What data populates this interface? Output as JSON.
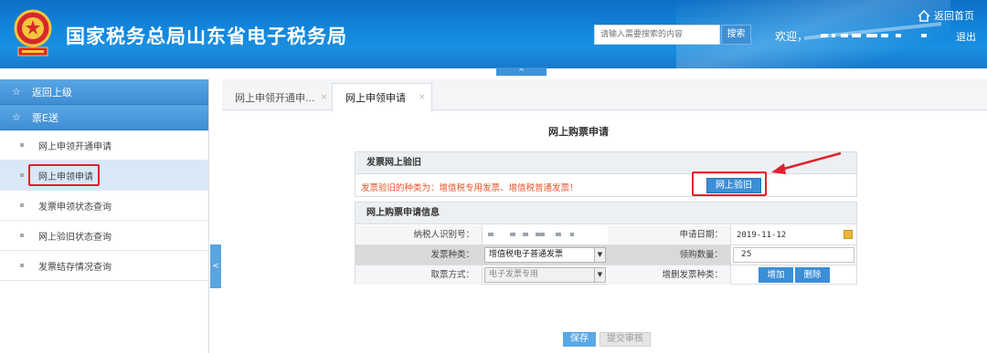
{
  "header": {
    "site_title": "国家税务总局山东省电子税务局",
    "search_placeholder": "请输入需要搜索的内容",
    "search_button": "搜索",
    "welcome": "欢迎，",
    "home_link": "返回首页",
    "logout": "退出",
    "collapse_arrow": "^"
  },
  "sidebar": {
    "back": "返回上级",
    "section": "票E送",
    "items": [
      {
        "label": "网上申领开通申请"
      },
      {
        "label": "网上申领申请"
      },
      {
        "label": "发票申领状态查询"
      },
      {
        "label": "网上验旧状态查询"
      },
      {
        "label": "发票结存情况查询"
      }
    ],
    "toggle": "<"
  },
  "tabs": [
    {
      "label": "网上申领开通申..."
    },
    {
      "label": "网上申领申请"
    }
  ],
  "form": {
    "title": "网上购票申请",
    "section1": {
      "heading": "发票网上验旧",
      "warning": "发票验旧的种类为：增值税专用发票、增值税普通发票！",
      "verify_button": "网上验旧"
    },
    "section2": {
      "heading": "网上购票申请信息",
      "taxpayer_id_label": "纳税人识别号：",
      "apply_date_label": "申请日期：",
      "apply_date": "2019-11-12",
      "invoice_type_label": "发票种类：",
      "invoice_type": "增值税电子普通发票",
      "qty_label": "领购数量：",
      "qty": "25",
      "pickup_label": "取票方式：",
      "pickup": "电子发票专用",
      "addremove_label": "增删发票种类：",
      "add_button": "增加",
      "delete_button": "删除"
    }
  },
  "footer": {
    "save": "保存",
    "submit": "提交审核"
  },
  "colors": {
    "header_blue": "#1287dc",
    "button_blue": "#3c8ed6",
    "highlight_red": "#e0202b",
    "warning_orange": "#e4542a"
  }
}
